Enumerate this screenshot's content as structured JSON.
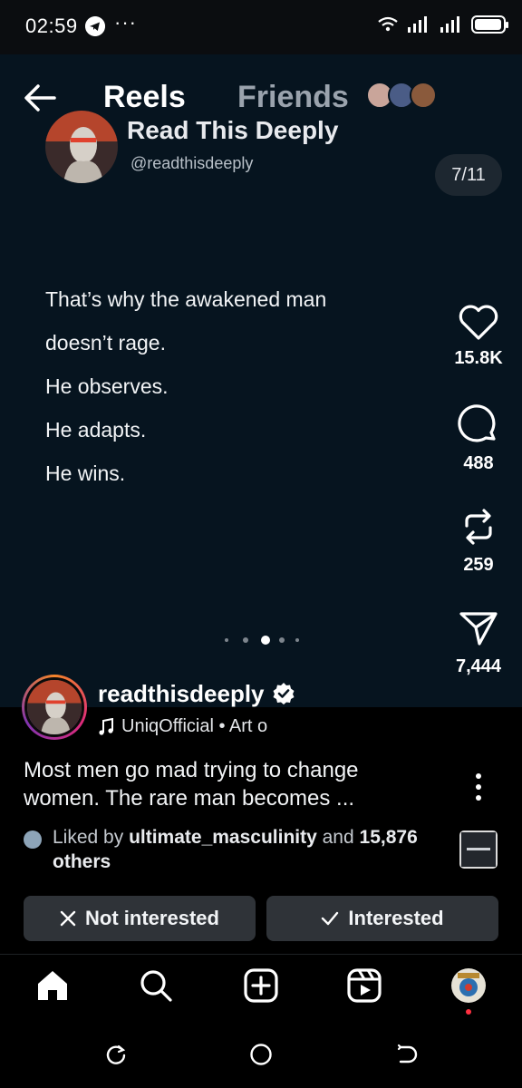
{
  "status": {
    "time": "02:59",
    "more": "···",
    "battery_level": 0.95
  },
  "topnav": {
    "tab_reels": "Reels",
    "tab_friends": "Friends"
  },
  "post": {
    "title": "Read This Deeply",
    "handle": "@readthisdeeply",
    "counter": "7/11",
    "lines": [
      "That’s why the awakened man",
      "doesn’t rage.",
      "He observes.",
      "He adapts.",
      "He wins."
    ],
    "active_slide": 3,
    "total_dots": 5
  },
  "actions": {
    "likes": "15.8K",
    "comments": "488",
    "reposts": "259",
    "shares": "7,444"
  },
  "creator": {
    "name": "readthisdeeply",
    "music": "UniqOfficial • Art o",
    "caption": "Most men go mad trying to change women. The rare man becomes ...",
    "liked_prefix": "Liked by ",
    "liked_user": "ultimate_masculinity",
    "liked_mid": " and ",
    "liked_count": "15,876",
    "liked_suffix": " others"
  },
  "buttons": {
    "not_interested": "Not interested",
    "interested": "Interested"
  },
  "colors": {
    "reel_bg": "#06141f",
    "button_bg": "#2f3338",
    "story_ring": "#dd2a7b",
    "notification": "#ff3040"
  }
}
